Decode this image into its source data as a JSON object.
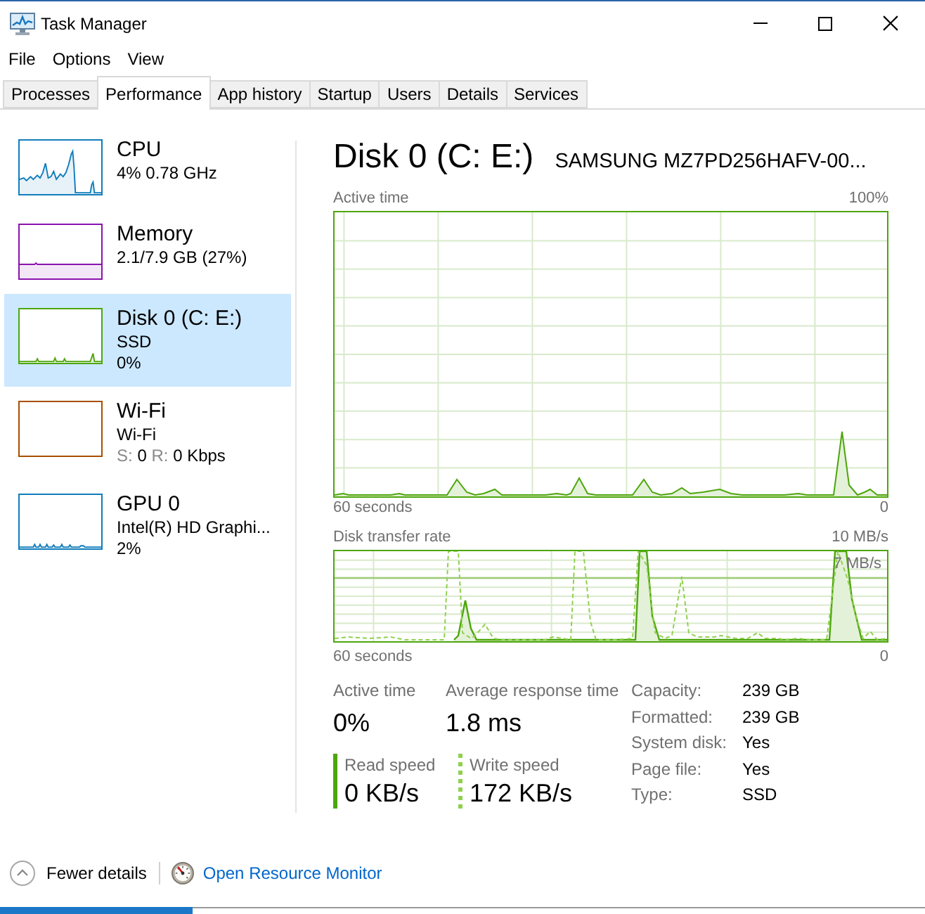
{
  "window": {
    "title": "Task Manager"
  },
  "menu": [
    {
      "label": "File"
    },
    {
      "label": "Options"
    },
    {
      "label": "View"
    }
  ],
  "tabs": [
    {
      "label": "Processes",
      "selected": false
    },
    {
      "label": "Performance",
      "selected": true
    },
    {
      "label": "App history",
      "selected": false
    },
    {
      "label": "Startup",
      "selected": false
    },
    {
      "label": "Users",
      "selected": false
    },
    {
      "label": "Details",
      "selected": false
    },
    {
      "label": "Services",
      "selected": false
    }
  ],
  "sidebar": {
    "items": [
      {
        "kind": "cpu",
        "title": "CPU",
        "color": "#117dbb",
        "selected": false,
        "details": [
          [
            {
              "text": "4% 0.78 GHz",
              "muted": false
            }
          ]
        ]
      },
      {
        "kind": "memory",
        "title": "Memory",
        "color": "#8b12ae",
        "selected": false,
        "details": [
          [
            {
              "text": "2.1/7.9 GB (27%)",
              "muted": false
            }
          ]
        ]
      },
      {
        "kind": "disk",
        "title": "Disk 0 (C: E:)",
        "color": "#4da60c",
        "selected": true,
        "details": [
          [
            {
              "text": "SSD",
              "muted": false
            }
          ],
          [
            {
              "text": "0%",
              "muted": false
            }
          ]
        ]
      },
      {
        "kind": "network",
        "title": "Wi-Fi",
        "color": "#a74f01",
        "selected": false,
        "details": [
          [
            {
              "text": "Wi-Fi",
              "muted": false
            }
          ],
          [
            {
              "text": "S:",
              "muted": true
            },
            {
              "text": "0",
              "muted": false
            },
            {
              "text": "R:",
              "muted": true
            },
            {
              "text": "0 Kbps",
              "muted": false
            }
          ]
        ]
      },
      {
        "kind": "gpu",
        "title": "GPU 0",
        "color": "#117dbb",
        "selected": false,
        "details": [
          [
            {
              "text": "Intel(R) HD Graphi...",
              "muted": false
            }
          ],
          [
            {
              "text": "2%",
              "muted": false
            }
          ]
        ]
      }
    ]
  },
  "detail": {
    "title": "Disk 0 (C: E:)",
    "model": "SAMSUNG MZ7PD256HAFV-00...",
    "active_time_chart": {
      "label": "Active time",
      "max": "100%",
      "start": "60 seconds",
      "end": "0"
    },
    "transfer_rate_chart": {
      "label": "Disk transfer rate",
      "max": "10 MB/s",
      "marker": "7 MB/s",
      "start": "60 seconds",
      "end": "0"
    },
    "stats": [
      {
        "label": "Active time",
        "value": "0%"
      },
      {
        "label": "Average response time",
        "value": "1.8 ms"
      }
    ],
    "speeds": [
      {
        "kind": "solid",
        "label": "Read speed",
        "value": "0 KB/s"
      },
      {
        "kind": "dotted",
        "label": "Write speed",
        "value": "172 KB/s"
      }
    ],
    "properties": [
      {
        "label": "Capacity:",
        "value": "239 GB"
      },
      {
        "label": "Formatted:",
        "value": "239 GB"
      },
      {
        "label": "System disk:",
        "value": "Yes"
      },
      {
        "label": "Page file:",
        "value": "Yes"
      },
      {
        "label": "Type:",
        "value": "SSD"
      }
    ]
  },
  "footer": {
    "fewer_details": "Fewer details",
    "resource_monitor_link": "Open Resource Monitor"
  }
}
